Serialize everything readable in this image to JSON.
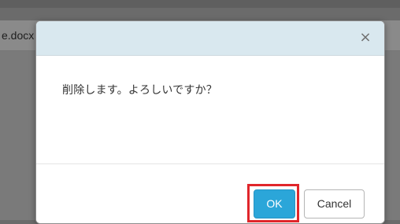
{
  "background": {
    "filename": "e.docx"
  },
  "dialog": {
    "close_symbol": "×",
    "message": "削除します。よろしいですか？",
    "ok_label": "OK",
    "cancel_label": "Cancel"
  },
  "colors": {
    "header_bg": "#d9e8ef",
    "ok_bg": "#2ba6d9",
    "highlight_border": "#e0262b",
    "overlay": "#6b6b6b"
  }
}
